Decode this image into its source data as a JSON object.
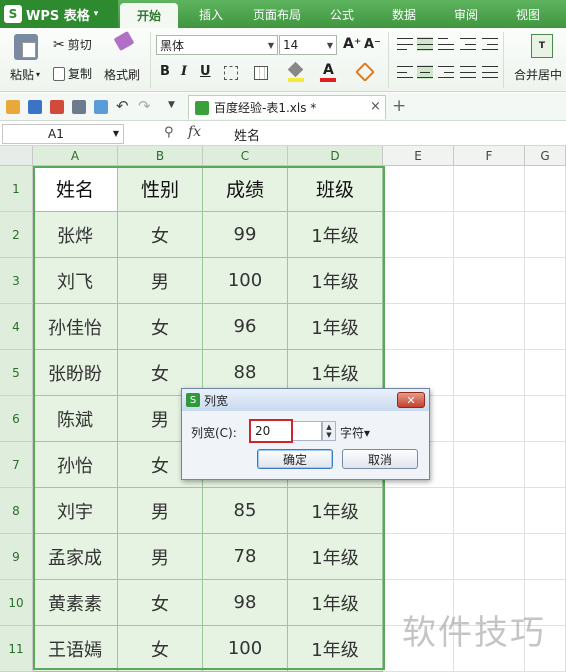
{
  "app": {
    "logo": "S",
    "name": "WPS 表格",
    "menu_arrow": "▾"
  },
  "tabs": [
    {
      "label": "开始",
      "active": true
    },
    {
      "label": "插入"
    },
    {
      "label": "页面布局"
    },
    {
      "label": "公式"
    },
    {
      "label": "数据"
    },
    {
      "label": "审阅"
    },
    {
      "label": "视图"
    }
  ],
  "ribbon": {
    "paste": "粘贴",
    "cut": "剪切",
    "copy": "复制",
    "format_painter": "格式刷",
    "font_name": "黑体",
    "font_size": "14",
    "grow_font": "A⁺",
    "shrink_font": "A⁻",
    "bold": "B",
    "italic": "I",
    "underline": "U",
    "font_color_letter": "A",
    "merge_center": "合并居中"
  },
  "document": {
    "tab_title": "百度经验-表1.xls *",
    "close": "×",
    "new_tab": "+"
  },
  "formula_bar": {
    "cell_ref": "A1",
    "fx": "fx",
    "value": "姓名"
  },
  "sheet": {
    "columns": [
      "A",
      "B",
      "C",
      "D",
      "E",
      "F",
      "G"
    ],
    "rows": [
      "1",
      "2",
      "3",
      "4",
      "5",
      "6",
      "7",
      "8",
      "9",
      "10",
      "11"
    ],
    "header": [
      "姓名",
      "性别",
      "成绩",
      "班级"
    ],
    "data": [
      [
        "张烨",
        "女",
        "99",
        "1年级"
      ],
      [
        "刘飞",
        "男",
        "100",
        "1年级"
      ],
      [
        "孙佳怡",
        "女",
        "96",
        "1年级"
      ],
      [
        "张盼盼",
        "女",
        "88",
        "1年级"
      ],
      [
        "陈斌",
        "男",
        "",
        "1年级"
      ],
      [
        "孙怡",
        "女",
        "",
        "1年级"
      ],
      [
        "刘宇",
        "男",
        "85",
        "1年级"
      ],
      [
        "孟家成",
        "男",
        "78",
        "1年级"
      ],
      [
        "黄素素",
        "女",
        "98",
        "1年级"
      ],
      [
        "王语嫣",
        "女",
        "100",
        "1年级"
      ]
    ]
  },
  "dialog": {
    "logo": "S",
    "title": "列宽",
    "close": "✕",
    "label": "列宽(C):",
    "value": "20",
    "unit": "字符▾",
    "ok": "确定",
    "cancel": "取消"
  },
  "watermark": "软件技巧",
  "colors": {
    "accent": "#3f963f",
    "selection": "#e6f3e2",
    "highlight": "#d0252a"
  }
}
